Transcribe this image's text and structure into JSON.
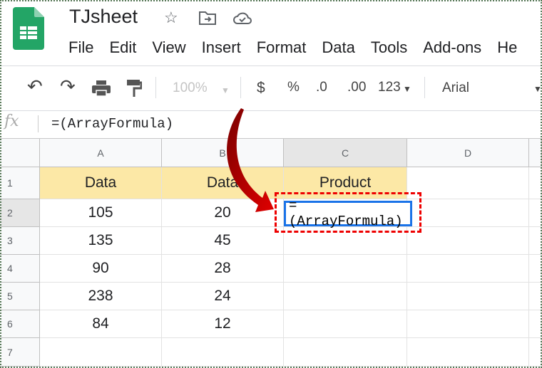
{
  "app": {
    "title": "TJsheet",
    "icons": [
      "star-icon",
      "move-to-folder-icon",
      "cloud-saved-icon"
    ]
  },
  "menu": [
    "File",
    "Edit",
    "View",
    "Insert",
    "Format",
    "Data",
    "Tools",
    "Add-ons",
    "He"
  ],
  "toolbar": {
    "zoom": "100%",
    "currency": "$",
    "percent": "%",
    "dec_decrease": ".0",
    "dec_increase": ".00",
    "number_format": "123",
    "font": "Arial"
  },
  "formula_bar": {
    "label": "fx",
    "value": "=(ArrayFormula)"
  },
  "columns": [
    "A",
    "B",
    "C",
    "D"
  ],
  "rows": [
    "1",
    "2",
    "3",
    "4",
    "5",
    "6",
    "7"
  ],
  "cells": [
    [
      "Data",
      "Data",
      "Product",
      ""
    ],
    [
      "105",
      "20",
      "=(ArrayFormula)",
      ""
    ],
    [
      "135",
      "45",
      "",
      ""
    ],
    [
      "90",
      "28",
      "",
      ""
    ],
    [
      "238",
      "24",
      "",
      ""
    ],
    [
      "84",
      "12",
      "",
      ""
    ],
    [
      "",
      "",
      "",
      ""
    ]
  ],
  "colors": {
    "header_fill": "#fce8a6",
    "selection": "#1a73e8",
    "annotation": "#e00000"
  }
}
